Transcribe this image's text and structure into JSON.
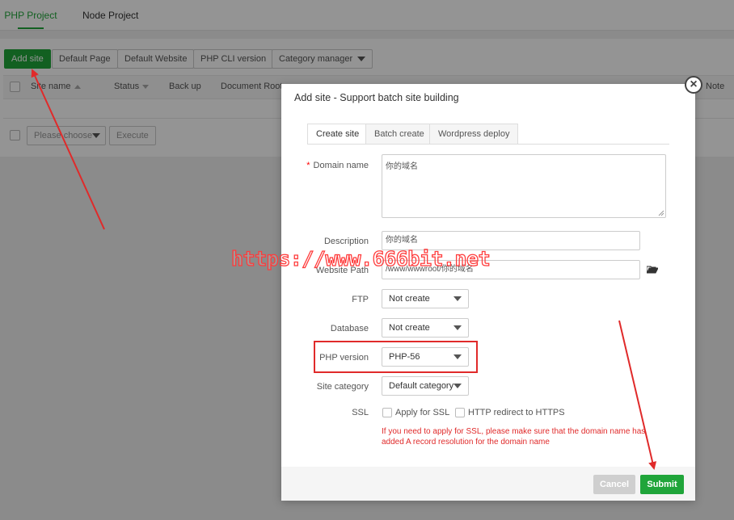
{
  "project_tabs": {
    "php": "PHP Project",
    "node": "Node Project"
  },
  "toolbar": {
    "add_site": "Add site",
    "default_page": "Default Page",
    "default_website": "Default Website",
    "php_cli": "PHP CLI version",
    "category_manager": "Category manager"
  },
  "table": {
    "headers": {
      "site_name": "Site name",
      "status": "Status",
      "backup": "Back up",
      "document_root": "Document Root",
      "note": "Note"
    },
    "batch_select": "Please choose",
    "execute": "Execute"
  },
  "modal": {
    "title": "Add site - Support batch site building",
    "close": "×",
    "tabs": {
      "create": "Create site",
      "batch": "Batch create",
      "wordpress": "Wordpress deploy"
    },
    "labels": {
      "required_mark": "*",
      "domain": "Domain name",
      "description": "Description",
      "website_path": "Website Path",
      "ftp": "FTP",
      "database": "Database",
      "php_version": "PHP version",
      "site_category": "Site category",
      "ssl": "SSL"
    },
    "values": {
      "domain": "你的域名",
      "description": "你的域名",
      "website_path": "/www/wwwroot/你的域名",
      "ftp": "Not create",
      "database": "Not create",
      "php_version": "PHP-56",
      "site_category": "Default category"
    },
    "ssl": {
      "apply": "Apply for SSL",
      "redirect": "HTTP redirect to HTTPS",
      "note": "If you need to apply for SSL, please make sure that the domain name has added A record resolution for the domain name"
    },
    "buttons": {
      "cancel": "Cancel",
      "submit": "Submit"
    }
  },
  "watermark": "https://www.666bit.net",
  "colors": {
    "accent_green": "#20a53a",
    "annotation_red": "#e02a2a",
    "cancel_gray": "#cfcfcf"
  }
}
